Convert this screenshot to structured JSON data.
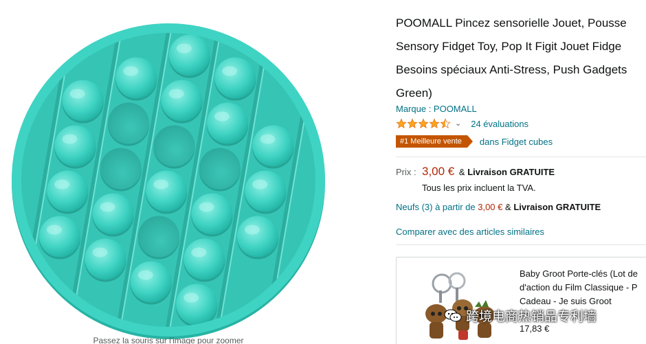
{
  "product": {
    "title_lines": [
      "POOMALL Pincez sensorielle Jouet, Pousse",
      "Sensory Fidget Toy, Pop It Figit Jouet Fidge",
      "Besoins spéciaux Anti-Stress, Push Gadgets",
      "Green)"
    ],
    "brand": "Marque : POOMALL",
    "rating": 4.5,
    "reviews": "24 évaluations",
    "badge": "#1 Meilleure vente",
    "badge_category": "dans Fidget cubes",
    "price_label": "Prix :",
    "price": "3,00 €",
    "price_amp": "&",
    "shipping": "Livraison GRATUITE",
    "tax_note": "Tous les prix incluent la TVA.",
    "offers_prefix": "Neufs (3) à partir de",
    "offers_price": "3,00 €",
    "offers_amp": "&",
    "offers_shipping": "Livraison GRATUITE",
    "compare": "Comparer avec des articles similaires",
    "zoom_hint": "Passez la souris sur l'image pour zoomer",
    "color": "#3FD3C3"
  },
  "ad": {
    "title_lines": [
      "Baby Groot Porte-clés (Lot de",
      "d'action du Film Classique - P",
      "Cadeau - Je suis Groot"
    ],
    "price": "17,83 €"
  },
  "watermark": "跨境电商热销品专利墙",
  "colors": {
    "link": "#007185",
    "price": "#B12704",
    "badge": "#C45500",
    "star": "#FFA41C"
  }
}
